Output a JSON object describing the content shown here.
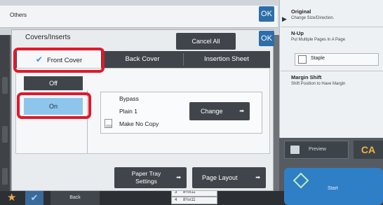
{
  "header": {
    "title": "Others",
    "ok_label": "OK"
  },
  "dialog": {
    "title": "Covers/Inserts",
    "ok_label": "OK",
    "cancel_all": "Cancel All",
    "tabs": [
      {
        "label": "Front Cover",
        "active": true
      },
      {
        "label": "Back Cover",
        "active": false
      },
      {
        "label": "Insertion Sheet",
        "active": false
      }
    ],
    "off_label": "Off",
    "on_label": "On",
    "paper": {
      "source": "Bypass",
      "type": "Plain 1",
      "copy": "Make No Copy"
    },
    "change_label": "Change",
    "paper_tray_settings": [
      "Paper Tray",
      "Settings"
    ],
    "page_layout": "Page Layout"
  },
  "right_panel": {
    "items": [
      {
        "title": "Original",
        "sub": "Change Size/Direction."
      },
      {
        "title": "N-Up",
        "sub": "Put Multiple Pages in A Page"
      },
      {
        "title": "Staple",
        "sub": ""
      },
      {
        "title": "Margin Shift",
        "sub": "Shift Position to Have Margin"
      }
    ],
    "preview_label": "Preview",
    "ca_label": "CA",
    "start_label": "Start"
  },
  "bottom_bar": {
    "back_label": "Back"
  },
  "trays": [
    {
      "num": "3",
      "size": "8½x11"
    },
    {
      "num": "4",
      "size": "8½x11"
    }
  ],
  "colors": {
    "highlight": "#e2182b",
    "on_button": "#8ec5ec",
    "dark_button": "#3f454b",
    "accent_blue": "#2c6ea8"
  }
}
